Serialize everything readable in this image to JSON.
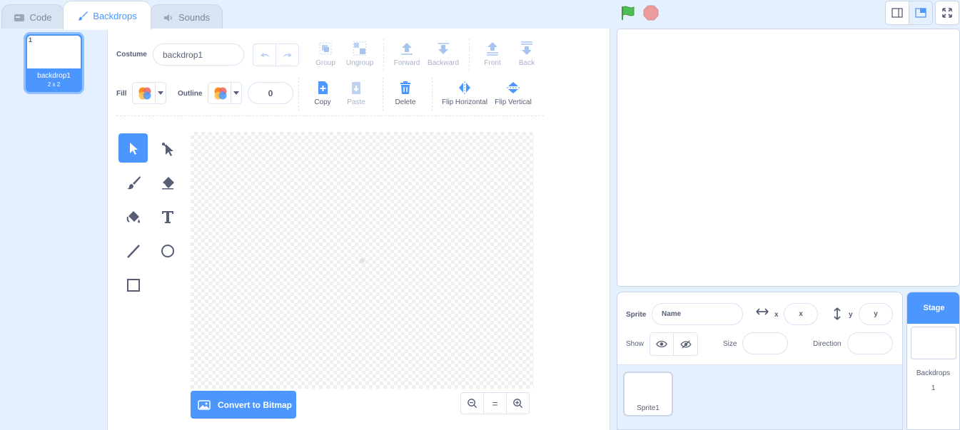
{
  "tabs": [
    {
      "label": "Code",
      "icon": "code-icon"
    },
    {
      "label": "Backdrops",
      "icon": "paintbrush-icon"
    },
    {
      "label": "Sounds",
      "icon": "speaker-icon"
    }
  ],
  "costume_list": {
    "items": [
      {
        "number": "1",
        "name": "backdrop1",
        "size": "2 x 2"
      }
    ]
  },
  "editor": {
    "costume_label": "Costume",
    "costume_name": "backdrop1",
    "fill_label": "Fill",
    "outline_label": "Outline",
    "outline_width": "0",
    "buttons": {
      "group": "Group",
      "ungroup": "Ungroup",
      "forward": "Forward",
      "backward": "Backward",
      "front": "Front",
      "back": "Back",
      "copy": "Copy",
      "paste": "Paste",
      "delete": "Delete",
      "flip_horizontal": "Flip Horizontal",
      "flip_vertical": "Flip Vertical"
    },
    "convert_button": "Convert to Bitmap",
    "zoom_reset": "="
  },
  "sprite_info": {
    "sprite_label": "Sprite",
    "name_placeholder": "Name",
    "x_label": "x",
    "x_placeholder": "x",
    "y_label": "y",
    "y_placeholder": "y",
    "show_label": "Show",
    "size_label": "Size",
    "direction_label": "Direction"
  },
  "sprites": [
    {
      "name": "Sprite1"
    }
  ],
  "stage_panel": {
    "header": "Stage",
    "backdrops_label": "Backdrops",
    "backdrops_count": "1"
  },
  "colors": {
    "accent": "#4c97ff",
    "background": "#e5f0ff",
    "text": "#575e75",
    "green_flag": "#4cbf56",
    "stop": "#ec9c9c"
  }
}
